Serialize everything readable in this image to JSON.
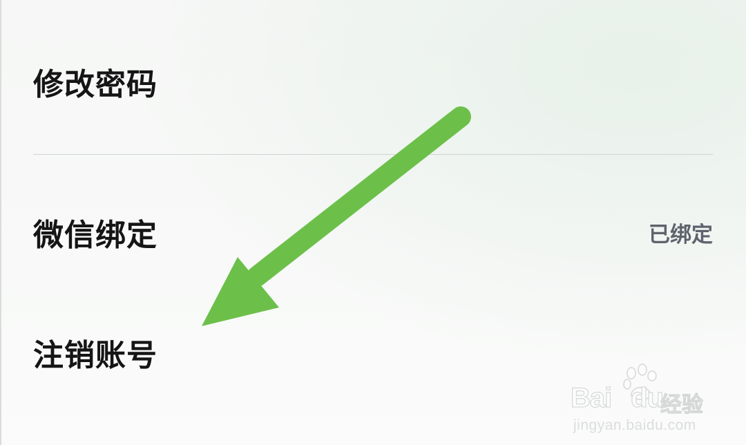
{
  "settings": {
    "items": [
      {
        "label": "修改密码",
        "value": ""
      },
      {
        "label": "微信绑定",
        "value": "已绑定"
      },
      {
        "label": "注销账号",
        "value": ""
      }
    ]
  },
  "annotation": {
    "arrow_color": "#6cc04a",
    "points_to": "注销账号"
  },
  "watermark": {
    "logo_text": "Bai du 经验",
    "url": "jingyan.baidu.com"
  },
  "colors": {
    "label": "#151515",
    "value": "#5e636d",
    "divider": "#cdd4d6",
    "arrow": "#6cc04a"
  }
}
